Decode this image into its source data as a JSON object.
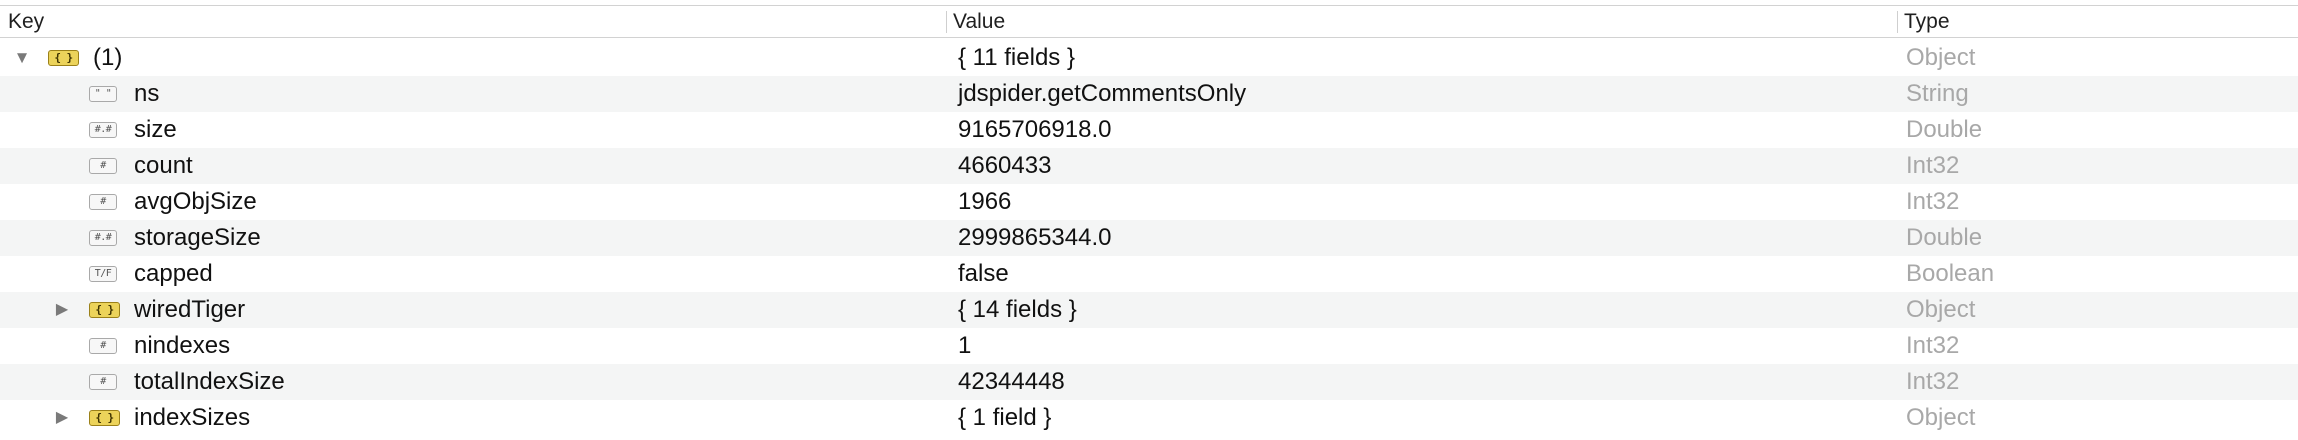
{
  "header": {
    "key_label": "Key",
    "value_label": "Value",
    "type_label": "Type"
  },
  "rows": [
    {
      "key": "(1)",
      "value": "{ 11 fields }",
      "type": "Object",
      "icon": "object-icon",
      "icon_text": "{ }",
      "expand": "expanded"
    },
    {
      "key": "ns",
      "value": "jdspider.getCommentsOnly",
      "type": "String",
      "icon": "string-icon",
      "icon_text": "\" \"",
      "expand": "none"
    },
    {
      "key": "size",
      "value": "9165706918.0",
      "type": "Double",
      "icon": "double-icon",
      "icon_text": "#.#",
      "expand": "none"
    },
    {
      "key": "count",
      "value": "4660433",
      "type": "Int32",
      "icon": "int32-icon",
      "icon_text": "#",
      "expand": "none"
    },
    {
      "key": "avgObjSize",
      "value": "1966",
      "type": "Int32",
      "icon": "int32-icon",
      "icon_text": "#",
      "expand": "none"
    },
    {
      "key": "storageSize",
      "value": "2999865344.0",
      "type": "Double",
      "icon": "double-icon",
      "icon_text": "#.#",
      "expand": "none"
    },
    {
      "key": "capped",
      "value": "false",
      "type": "Boolean",
      "icon": "boolean-icon",
      "icon_text": "T/F",
      "expand": "none"
    },
    {
      "key": "wiredTiger",
      "value": "{ 14 fields }",
      "type": "Object",
      "icon": "object-icon",
      "icon_text": "{ }",
      "expand": "collapsed"
    },
    {
      "key": "nindexes",
      "value": "1",
      "type": "Int32",
      "icon": "int32-icon",
      "icon_text": "#",
      "expand": "none"
    },
    {
      "key": "totalIndexSize",
      "value": "42344448",
      "type": "Int32",
      "icon": "int32-icon",
      "icon_text": "#",
      "expand": "none"
    },
    {
      "key": "indexSizes",
      "value": "{ 1 field }",
      "type": "Object",
      "icon": "object-icon",
      "icon_text": "{ }",
      "expand": "collapsed"
    }
  ],
  "disclosure_glyphs": {
    "expanded": "▼",
    "collapsed": "▶"
  },
  "colors": {
    "object_icon_fill": "#ecd35a",
    "type_text": "#a8a8a8",
    "alt_row": "#f4f5f5"
  }
}
